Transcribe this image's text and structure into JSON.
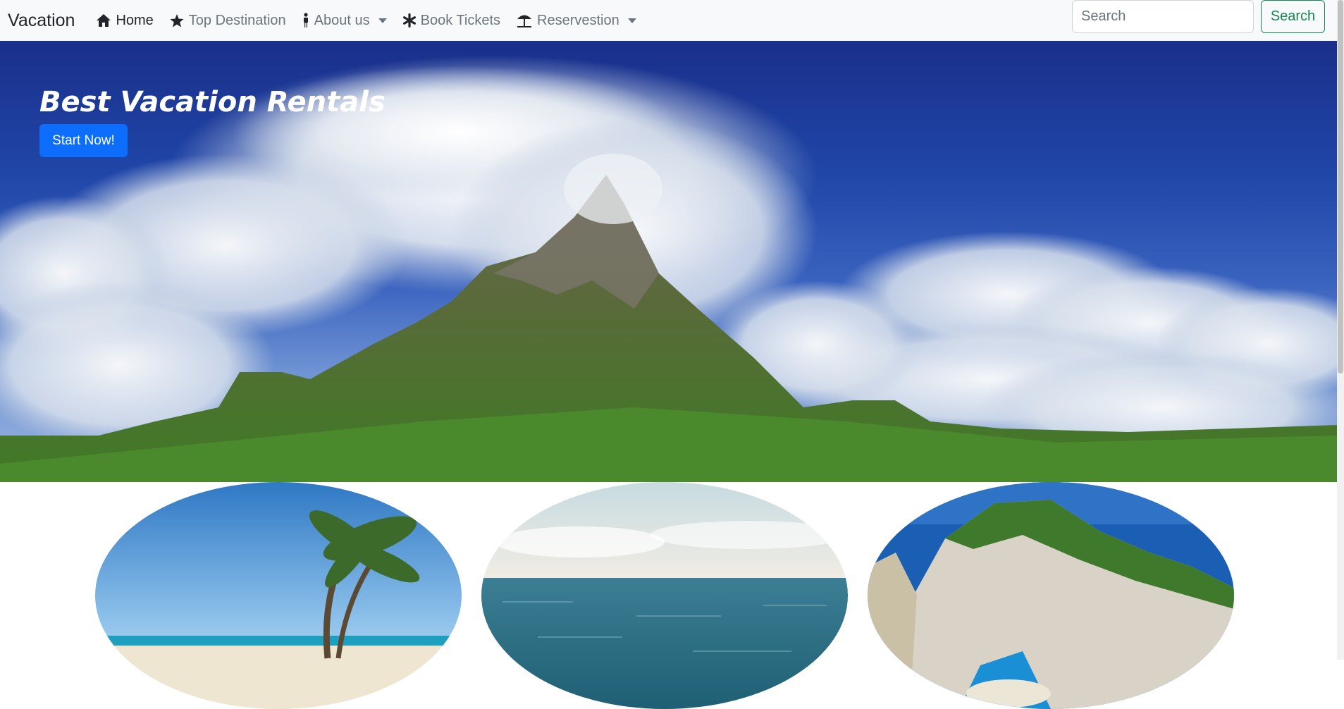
{
  "navbar": {
    "brand": "Vacation",
    "items": [
      {
        "label": "Home",
        "icon": "home-icon",
        "active": true
      },
      {
        "label": "Top Destination",
        "icon": "star-icon"
      },
      {
        "label": "About us",
        "icon": "person-icon",
        "dropdown": true
      },
      {
        "label": "Book Tickets",
        "icon": "asterisk-icon"
      },
      {
        "label": "Reservestion",
        "icon": "umbrella-icon",
        "dropdown": true
      }
    ],
    "search_placeholder": "Search",
    "search_button": "Search"
  },
  "hero": {
    "title": "Best Vacation Rentals",
    "button": "Start Now!"
  },
  "gallery": [
    {
      "subject": "palm-beach"
    },
    {
      "subject": "ocean-horizon"
    },
    {
      "subject": "cliff-cove"
    }
  ],
  "colors": {
    "primary": "#0d6efd",
    "success": "#198754",
    "navbar_bg": "#f8f9fa"
  }
}
